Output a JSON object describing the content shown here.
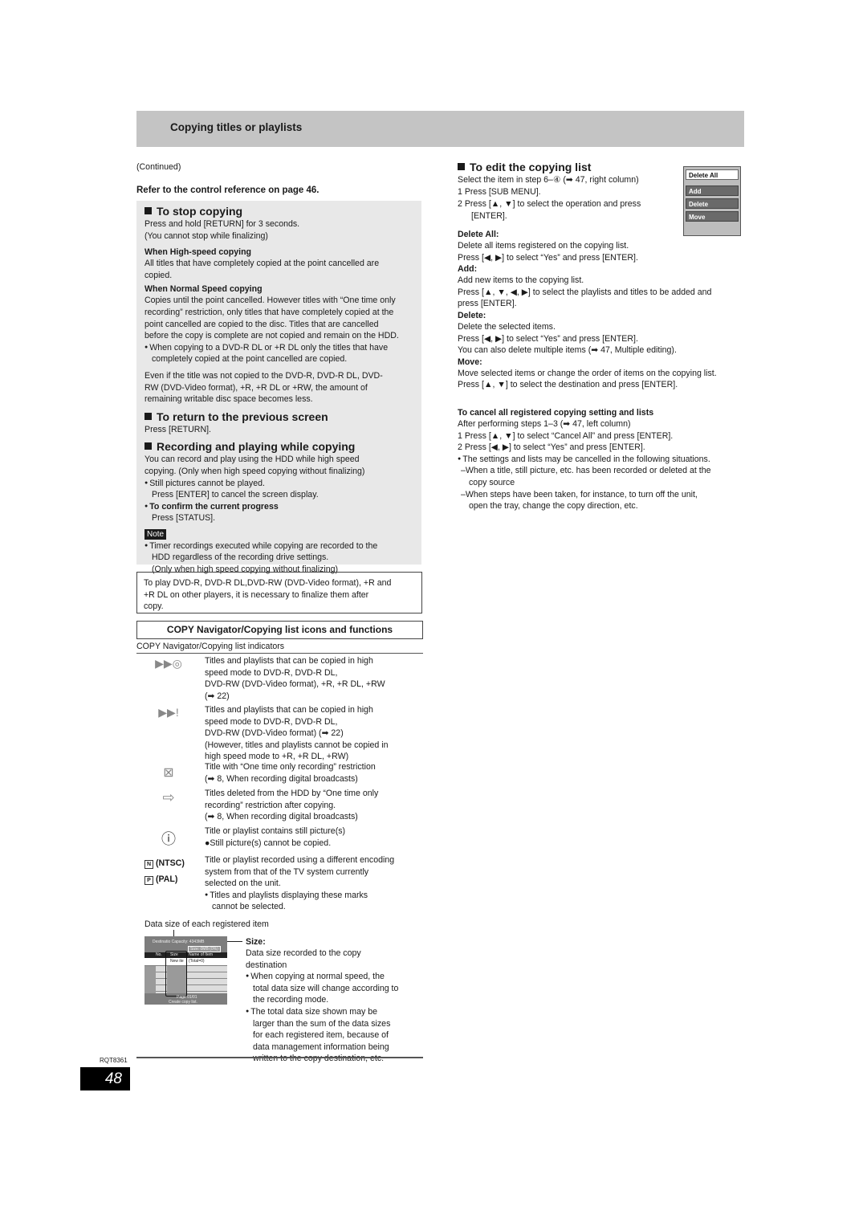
{
  "header": {
    "title": "Copying titles or playlists"
  },
  "continued": "(Continued)",
  "control_ref": "Refer to the control reference on page 46.",
  "stop_copying": {
    "heading": "To stop copying",
    "lines": [
      "Press and hold [RETURN] for 3 seconds.",
      "(You cannot stop while finalizing)"
    ],
    "high_speed_heading": "When High-speed copying",
    "high_speed_text": [
      "All titles that have completely copied at the point cancelled are",
      "copied."
    ],
    "normal_speed_heading": "When Normal Speed copying",
    "normal_speed_text": [
      "Copies until the point cancelled. However titles with “One time only",
      "recording” restriction, only titles that have completely copied at the",
      "point cancelled are copied to the disc. Titles that are cancelled",
      "before the copy is complete are not copied and remain on the HDD."
    ],
    "normal_speed_bullet": [
      "When copying to a DVD-R DL or +R DL only the titles that have",
      "completely copied at the point cancelled are copied."
    ],
    "even_if_text": [
      "Even if the title was not copied to the DVD-R, DVD-R DL, DVD-",
      "RW (DVD-Video format), +R, +R DL or +RW, the amount of",
      "remaining writable disc space becomes less."
    ]
  },
  "return_screen": {
    "heading": "To return to the previous screen",
    "text": "Press [RETURN]."
  },
  "rec_play": {
    "heading": "Recording and playing while copying",
    "text": [
      "You can record and play using the HDD while high speed",
      "copying. (Only when high speed copying without finalizing)"
    ],
    "bullet1": "Still pictures cannot be played.",
    "enter_text": "Press [ENTER] to cancel the screen display.",
    "bullet2_heading": "To confirm the current progress",
    "status_text": "Press [STATUS].",
    "note_label": "Note",
    "note_bullet": [
      "Timer recordings executed while copying are recorded to the",
      "HDD regardless of the recording drive settings.",
      "(Only when high speed copying without finalizing)"
    ]
  },
  "finalize_box": [
    "To play DVD-R, DVD-R DL,DVD-RW (DVD-Video format), +R and",
    "+R DL on other players, it is necessary to finalize them after",
    "copy."
  ],
  "icons_section": {
    "title": "COPY Navigator/Copying list icons and functions",
    "subtitle": "COPY Navigator/Copying list indicators",
    "items": [
      {
        "icon": "high-speed-disc-icon",
        "glyph": "▶▶◎",
        "text": [
          "Titles and playlists that can be copied in high",
          "speed mode to DVD-R, DVD-R DL,",
          "DVD-RW (DVD-Video format), +R, +R DL, +RW",
          "(➡ 22)"
        ]
      },
      {
        "icon": "high-speed-exclaim-icon",
        "glyph": "▶▶!",
        "text": [
          "Titles and playlists that can be copied in high",
          "speed mode to DVD-R, DVD-R DL,",
          "DVD-RW (DVD-Video format) (➡ 22)",
          "(However, titles and playlists cannot be copied in",
          "high speed mode to +R, +R DL, +RW)"
        ]
      },
      {
        "icon": "one-time-recording-icon",
        "glyph": "⊠",
        "text": [
          "Title with “One time only recording” restriction",
          "(➡ 8, When recording digital broadcasts)"
        ]
      },
      {
        "icon": "deleted-after-copy-icon",
        "glyph": "⇨",
        "text": [
          "Titles deleted from the HDD by “One time only",
          "recording” restriction after copying.",
          "(➡ 8, When recording digital broadcasts)"
        ]
      },
      {
        "icon": "still-picture-icon",
        "glyph": "ⓘ",
        "text": [
          "Title or playlist contains still picture(s)",
          "●Still picture(s) cannot be copied."
        ]
      }
    ],
    "encoding": {
      "ntsc_label": "(NTSC)",
      "pal_label": "(PAL)",
      "ntsc_glyph": "N",
      "pal_glyph": "P",
      "text": [
        "Title or playlist recorded using a different encoding",
        "system from that of the TV system currently",
        "selected on the unit."
      ],
      "bullet": [
        "Titles and playlists displaying these marks",
        "cannot be selected."
      ]
    }
  },
  "data_size": {
    "caption": "Data size of each registered item",
    "mini_screen": {
      "top_label": "Destinatio  Capacity: 4343MB",
      "size_label": "Size:     0MB (0%)",
      "col_no": "No.",
      "col_size": "Size",
      "col_name": "Name of Item",
      "row1_size": "New ite",
      "row1_name": "(Total=0)",
      "page": "Page 01/01",
      "footer": "Create copy list."
    },
    "size_heading": "Size:",
    "size_text": [
      "Data size recorded to the copy",
      "destination"
    ],
    "bullet1": [
      "When copying at normal speed, the",
      "total data size will change according to",
      "the recording mode."
    ],
    "bullet2": [
      "The total data size shown may be",
      "larger than the sum of the data sizes",
      "for each registered item, because of",
      "data management information being",
      "written to the copy destination, etc."
    ]
  },
  "edit_list": {
    "heading": "To edit the copying list",
    "intro": "Select the item in step 6–④ (➡ 47, right column)",
    "steps": [
      "1  Press [SUB MENU].",
      "2  Press [▲, ▼] to select the operation and press",
      "[ENTER]."
    ],
    "menu": [
      "Delete All",
      "Add",
      "Delete",
      "Move"
    ],
    "delete_all": {
      "heading": "Delete All:",
      "lines": [
        "Delete all items registered on the copying list.",
        "Press [◀, ▶] to select “Yes” and press [ENTER]."
      ]
    },
    "add": {
      "heading": "Add:",
      "lines": [
        "Add new items to the copying list.",
        "Press [▲, ▼, ◀, ▶] to select the playlists and titles to be added and",
        "press [ENTER]."
      ]
    },
    "delete": {
      "heading": "Delete:",
      "lines": [
        "Delete the selected items.",
        "Press [◀, ▶] to select “Yes” and press [ENTER].",
        "You can also delete multiple items (➡ 47, Multiple editing)."
      ]
    },
    "move": {
      "heading": "Move:",
      "lines": [
        "Move selected items or change the order of items on the copying list.",
        "Press [▲, ▼] to select the destination and press [ENTER]."
      ]
    }
  },
  "cancel_all": {
    "heading": "To cancel all registered copying setting and lists",
    "intro": "After performing steps 1–3 (➡ 47, left column)",
    "steps": [
      "1  Press [▲, ▼] to select “Cancel All” and press [ENTER].",
      "2  Press [◀, ▶] to select “Yes” and press [ENTER]."
    ],
    "bullet": "The settings and lists may be cancelled in the following situations.",
    "dashes": [
      [
        "–When a title, still picture, etc. has been recorded or deleted at the",
        "copy source"
      ],
      [
        "–When steps have been taken, for instance, to turn off the unit,",
        "open the tray, change the copy direction, etc."
      ]
    ]
  },
  "footer": {
    "code": "RQT8361",
    "page": "48"
  }
}
